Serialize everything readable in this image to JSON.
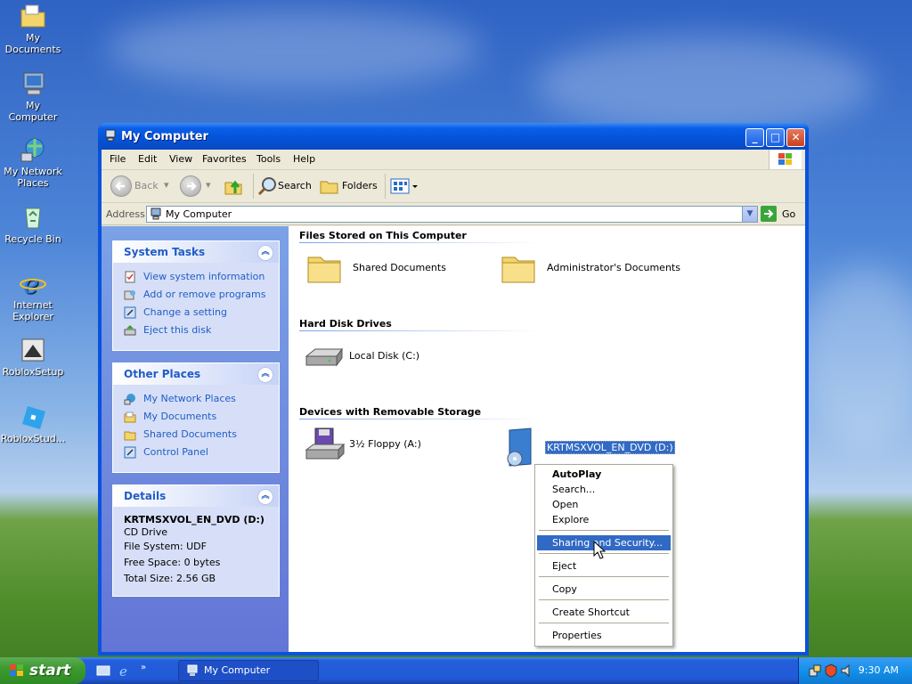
{
  "desktop": {
    "icons": [
      {
        "label": "My Documents"
      },
      {
        "label": "My Computer"
      },
      {
        "label": "My Network Places"
      },
      {
        "label": "Recycle Bin"
      },
      {
        "label": "Internet Explorer"
      },
      {
        "label": "RobloxSetup"
      },
      {
        "label": "RobloxStud..."
      }
    ]
  },
  "window": {
    "title": "My Computer",
    "menu": [
      "File",
      "Edit",
      "View",
      "Favorites",
      "Tools",
      "Help"
    ],
    "toolbar": {
      "back": "Back",
      "search": "Search",
      "folders": "Folders"
    },
    "address": {
      "label": "Address",
      "value": "My Computer",
      "go": "Go"
    },
    "system_tasks": {
      "title": "System Tasks",
      "items": [
        "View system information",
        "Add or remove programs",
        "Change a setting",
        "Eject this disk"
      ]
    },
    "other_places": {
      "title": "Other Places",
      "items": [
        "My Network Places",
        "My Documents",
        "Shared Documents",
        "Control Panel"
      ]
    },
    "details": {
      "title": "Details",
      "name": "KRTMSXVOL_EN_DVD (D:)",
      "type": "CD Drive",
      "file_system": "File System: UDF",
      "free_space": "Free Space: 0 bytes",
      "total_size": "Total Size: 2.56 GB"
    },
    "groups": {
      "files": {
        "title": "Files Stored on This Computer",
        "items": [
          "Shared Documents",
          "Administrator's Documents"
        ]
      },
      "hdd": {
        "title": "Hard Disk Drives",
        "items": [
          "Local Disk (C:)"
        ]
      },
      "removable": {
        "title": "Devices with Removable Storage",
        "items": [
          "3½ Floppy (A:)",
          "KRTMSXVOL_EN_DVD (D:)"
        ]
      }
    }
  },
  "context_menu": {
    "items": [
      "AutoPlay",
      "Search...",
      "Open",
      "Explore",
      "Sharing and Security...",
      "Eject",
      "Copy",
      "Create Shortcut",
      "Properties"
    ],
    "highlighted": "Sharing and Security..."
  },
  "taskbar": {
    "start": "start",
    "task": "My Computer",
    "clock": "9:30 AM"
  }
}
